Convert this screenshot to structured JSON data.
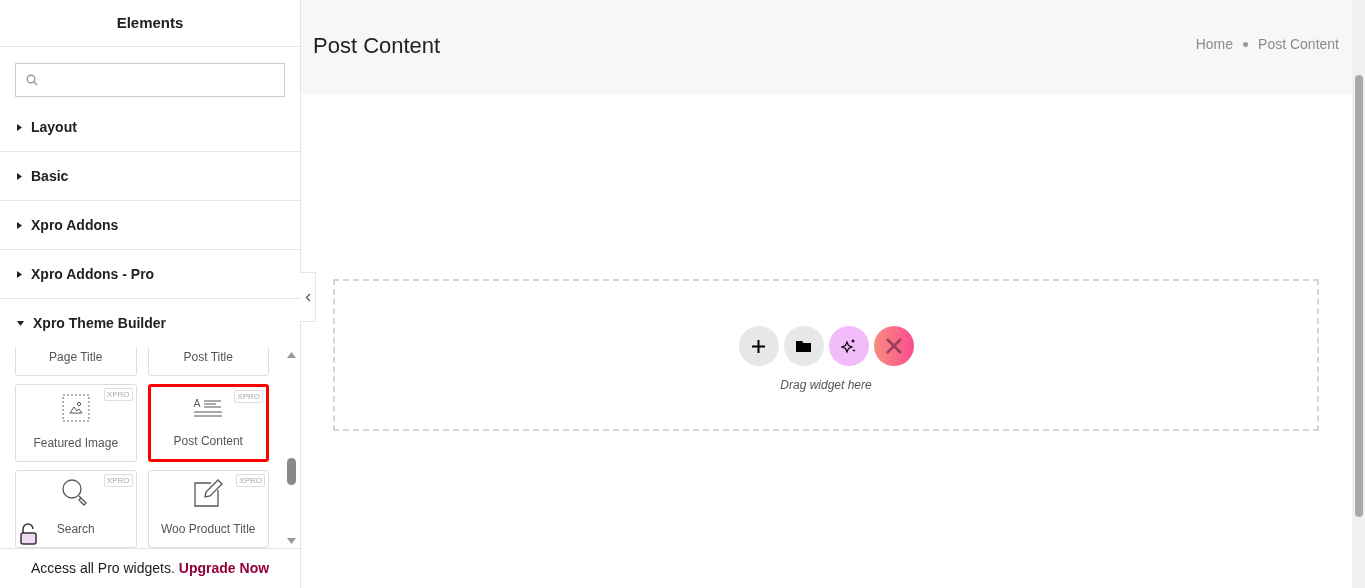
{
  "sidebar": {
    "title": "Elements",
    "categories": [
      {
        "label": "Layout",
        "expanded": false
      },
      {
        "label": "Basic",
        "expanded": false
      },
      {
        "label": "Xpro Addons",
        "expanded": false
      },
      {
        "label": "Xpro Addons - Pro",
        "expanded": false
      },
      {
        "label": "Xpro Theme Builder",
        "expanded": true
      }
    ],
    "widgets": [
      {
        "label": "Page Title",
        "kind": "none",
        "selected": false
      },
      {
        "label": "Post Title",
        "kind": "none",
        "selected": false
      },
      {
        "label": "Featured Image",
        "kind": "image",
        "badge": "XPRO",
        "selected": false
      },
      {
        "label": "Post Content",
        "kind": "text",
        "badge": "XPRO",
        "selected": true
      },
      {
        "label": "Search",
        "kind": "search",
        "badge": "XPRO",
        "selected": false
      },
      {
        "label": "Woo Product Title",
        "kind": "edit",
        "badge": "XPRO",
        "selected": false
      }
    ],
    "promo": {
      "text": "Access all Pro widgets.",
      "link": "Upgrade Now"
    }
  },
  "page": {
    "title": "Post Content",
    "breadcrumb": [
      "Home",
      "Post Content"
    ],
    "dropzone": {
      "hint": "Drag widget here"
    }
  }
}
